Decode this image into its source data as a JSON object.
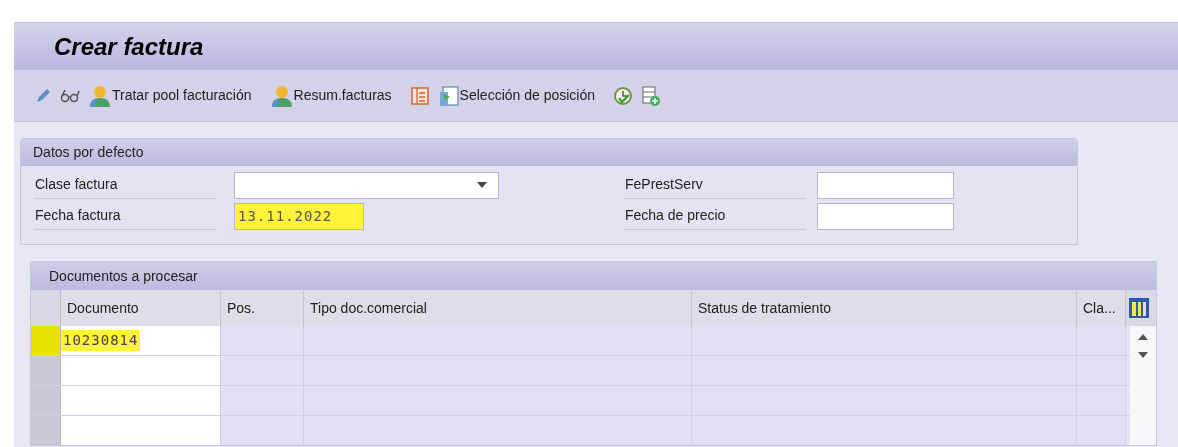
{
  "window": {
    "title": "Crear factura"
  },
  "toolbar": [
    {
      "kind": "pencil"
    },
    {
      "kind": "glasses"
    },
    {
      "kind": "person",
      "label": "Tratar pool facturación"
    },
    {
      "kind": "person",
      "label": "Resum.facturas"
    },
    {
      "kind": "list"
    },
    {
      "kind": "doc",
      "label": "Selección de posición"
    },
    {
      "kind": "clock"
    },
    {
      "kind": "add"
    }
  ],
  "defaults": {
    "title": "Datos por defecto",
    "fields": [
      {
        "label": "Clase factura",
        "kind": "dropdown",
        "highlighted": false
      },
      {
        "label": "Fecha factura",
        "value": "13.11.2022",
        "kind": "text",
        "highlighted": true
      },
      {
        "label": "FePrestServ",
        "kind": "text",
        "highlighted": false
      },
      {
        "label": "Fecha de precio",
        "kind": "text",
        "highlighted": false
      }
    ]
  },
  "table": {
    "title": "Documentos a procesar",
    "columns": [
      "Documento",
      "Pos.",
      "Tipo doc.comercial",
      "Status de tratamiento",
      "Cla..."
    ],
    "rows": [
      {
        "selected": true,
        "cells": [
          {
            "text": "10230814",
            "highlighted": true
          }
        ]
      },
      {
        "selected": false,
        "cells": []
      },
      {
        "selected": false,
        "cells": []
      },
      {
        "selected": false,
        "cells": []
      }
    ]
  }
}
